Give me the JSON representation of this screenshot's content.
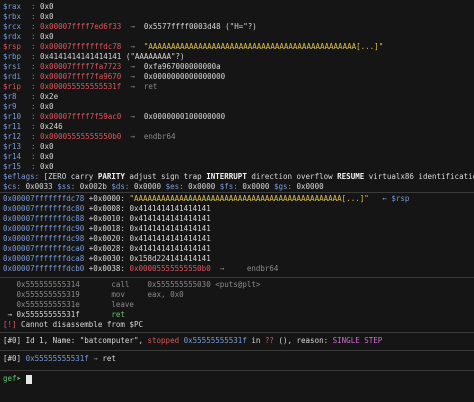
{
  "registers": [
    {
      "name": "$rax",
      "value": "0x0",
      "extra": ""
    },
    {
      "name": "$rbx",
      "value": "0x0",
      "extra": ""
    },
    {
      "name": "$rcx",
      "value": "0x00007ffff7ed6f33",
      "arrow": "→",
      "extra": "0x5577ffff0003d48 (\"H=\"?)"
    },
    {
      "name": "$rdx",
      "value": "0x0",
      "extra": ""
    },
    {
      "name": "$rsp",
      "value": "0x00007fffffffdc78",
      "arrow": "→",
      "extra": "\"AAAAAAAAAAAAAAAAAAAAAAAAAAAAAAAAAAAAAAAAAAAAAA[...]\""
    },
    {
      "name": "$rbp",
      "value": "0x4141414141414141 (\"AAAAAAAA\"?)",
      "extra": ""
    },
    {
      "name": "$rsi",
      "value": "0x00007ffff7fa7723",
      "arrow": "→",
      "extra": "0xfa967000000000a"
    },
    {
      "name": "$rdi",
      "value": "0x00007ffff7fa9670",
      "arrow": "→",
      "extra": "0x0000000000000000"
    },
    {
      "name": "$rip",
      "value": "0x000055555555531f",
      "arrow": "→",
      "extra": "ret"
    },
    {
      "name": "$r8",
      "value": "0x2e",
      "extra": ""
    },
    {
      "name": "$r9",
      "value": "0x0",
      "extra": ""
    },
    {
      "name": "$r10",
      "value": "0x00007ffff7f59ac0",
      "arrow": "→",
      "extra": "0x0000000100000000"
    },
    {
      "name": "$r11",
      "value": "0x246",
      "extra": ""
    },
    {
      "name": "$r12",
      "value": "0x00005555555550b0",
      "arrow": "→",
      "extra": "endbr64"
    },
    {
      "name": "$r13",
      "value": "0x0",
      "extra": ""
    },
    {
      "name": "$r14",
      "value": "0x0",
      "extra": ""
    },
    {
      "name": "$r15",
      "value": "0x0",
      "extra": ""
    }
  ],
  "eflags": {
    "label": "$eflags:",
    "parts": [
      "[ZERO carry ",
      "PARITY",
      " adjust sign trap ",
      "INTERRUPT",
      " direction overflow ",
      "RESUME",
      " virtualx86 identification]"
    ]
  },
  "segments": "$cs: 0x0033 $ss: 0x002b $ds: 0x0000 $es: 0x0000 $fs: 0x0000 $gs: 0x0000",
  "stack": [
    {
      "addr": "0x00007fffffffdc78",
      "off": "+0x0000:",
      "val": "\"AAAAAAAAAAAAAAAAAAAAAAAAAAAAAAAAAAAAAAAAAAAAAA[...]\"",
      "tag": "← $rsp"
    },
    {
      "addr": "0x00007fffffffdc80",
      "off": "+0x0008:",
      "val": "0x4141414141414141",
      "tag": ""
    },
    {
      "addr": "0x00007fffffffdc88",
      "off": "+0x0010:",
      "val": "0x4141414141414141",
      "tag": ""
    },
    {
      "addr": "0x00007fffffffdc90",
      "off": "+0x0018:",
      "val": "0x4141414141414141",
      "tag": ""
    },
    {
      "addr": "0x00007fffffffdc98",
      "off": "+0x0020:",
      "val": "0x4141414141414141",
      "tag": ""
    },
    {
      "addr": "0x00007fffffffdca0",
      "off": "+0x0028:",
      "val": "0x4141414141414141",
      "tag": ""
    },
    {
      "addr": "0x00007fffffffdca8",
      "off": "+0x0030:",
      "val": "0x158d224141414141",
      "tag": ""
    },
    {
      "addr": "0x00007fffffffdcb0",
      "off": "+0x0038:",
      "val": "0x00005555555550b0",
      "arrow": "→",
      "tag": "endbr64"
    }
  ],
  "code": [
    {
      "marker": "",
      "addr": "0x555555555314",
      "op": "call",
      "args": "0x555555555030 <puts@plt>"
    },
    {
      "marker": "",
      "addr": "0x555555555319",
      "op": "mov",
      "args": "eax, 0x0"
    },
    {
      "marker": "",
      "addr": "0x55555555531e",
      "op": "leave",
      "args": ""
    },
    {
      "marker": "→",
      "addr": "0x55555555531f",
      "op": "ret",
      "args": ""
    }
  ],
  "disasm_error": {
    "tag": "[!]",
    "text": "Cannot disassemble from $PC"
  },
  "thread": {
    "id": "[#0]",
    "pre": "Id 1, Name: \"batcomputer\",",
    "state": "stopped",
    "addr": "0x55555555531f",
    "mid": "in",
    "fn": "??",
    "post": "(), reason:",
    "reason": "SINGLE STEP"
  },
  "trace": {
    "id": "[#0]",
    "addr": "0x55555555531f",
    "arrow": "→",
    "fn": "ret"
  },
  "prompt": "gef➤"
}
